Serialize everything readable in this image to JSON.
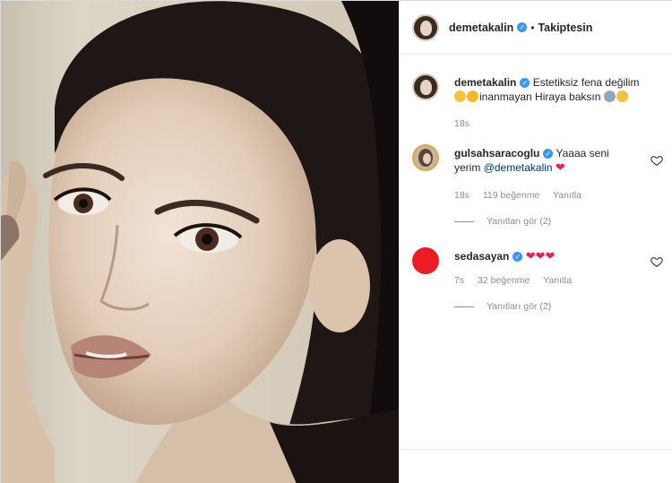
{
  "post": {
    "author": "demetakalin",
    "separator": "•",
    "follow_label": "Takiptesin"
  },
  "caption": {
    "username": "demetakalin",
    "text_part1": "Estetiksiz fena değilim",
    "text_part2": "inanmayan Hiraya baksın",
    "emojis_before": [
      "smiling-face-icon",
      "bee-face-icon"
    ],
    "emojis_after": [
      "graduation-cap-icon",
      "worried-face-icon"
    ],
    "time": "18s"
  },
  "comments": [
    {
      "username": "gulsahsaracoglu",
      "text_part1": "Yaaaa seni",
      "text_part2": "yerim",
      "mention": "@demetakalin",
      "hearts": "❤",
      "time": "18s",
      "likes": "119 beğenme",
      "reply_label": "Yanıtla",
      "view_replies": "Yanıtları gör (2)"
    },
    {
      "username": "sedasayan",
      "hearts": "❤❤❤",
      "time": "7s",
      "likes": "32 beğenme",
      "reply_label": "Yanıtla",
      "view_replies": "Yanıtları gör (2)"
    }
  ],
  "colors": {
    "verified": "#3897f0",
    "heart": "#e0245e",
    "muted": "#8e8e8e",
    "sedasayan_avatar": "#ed1c24"
  }
}
